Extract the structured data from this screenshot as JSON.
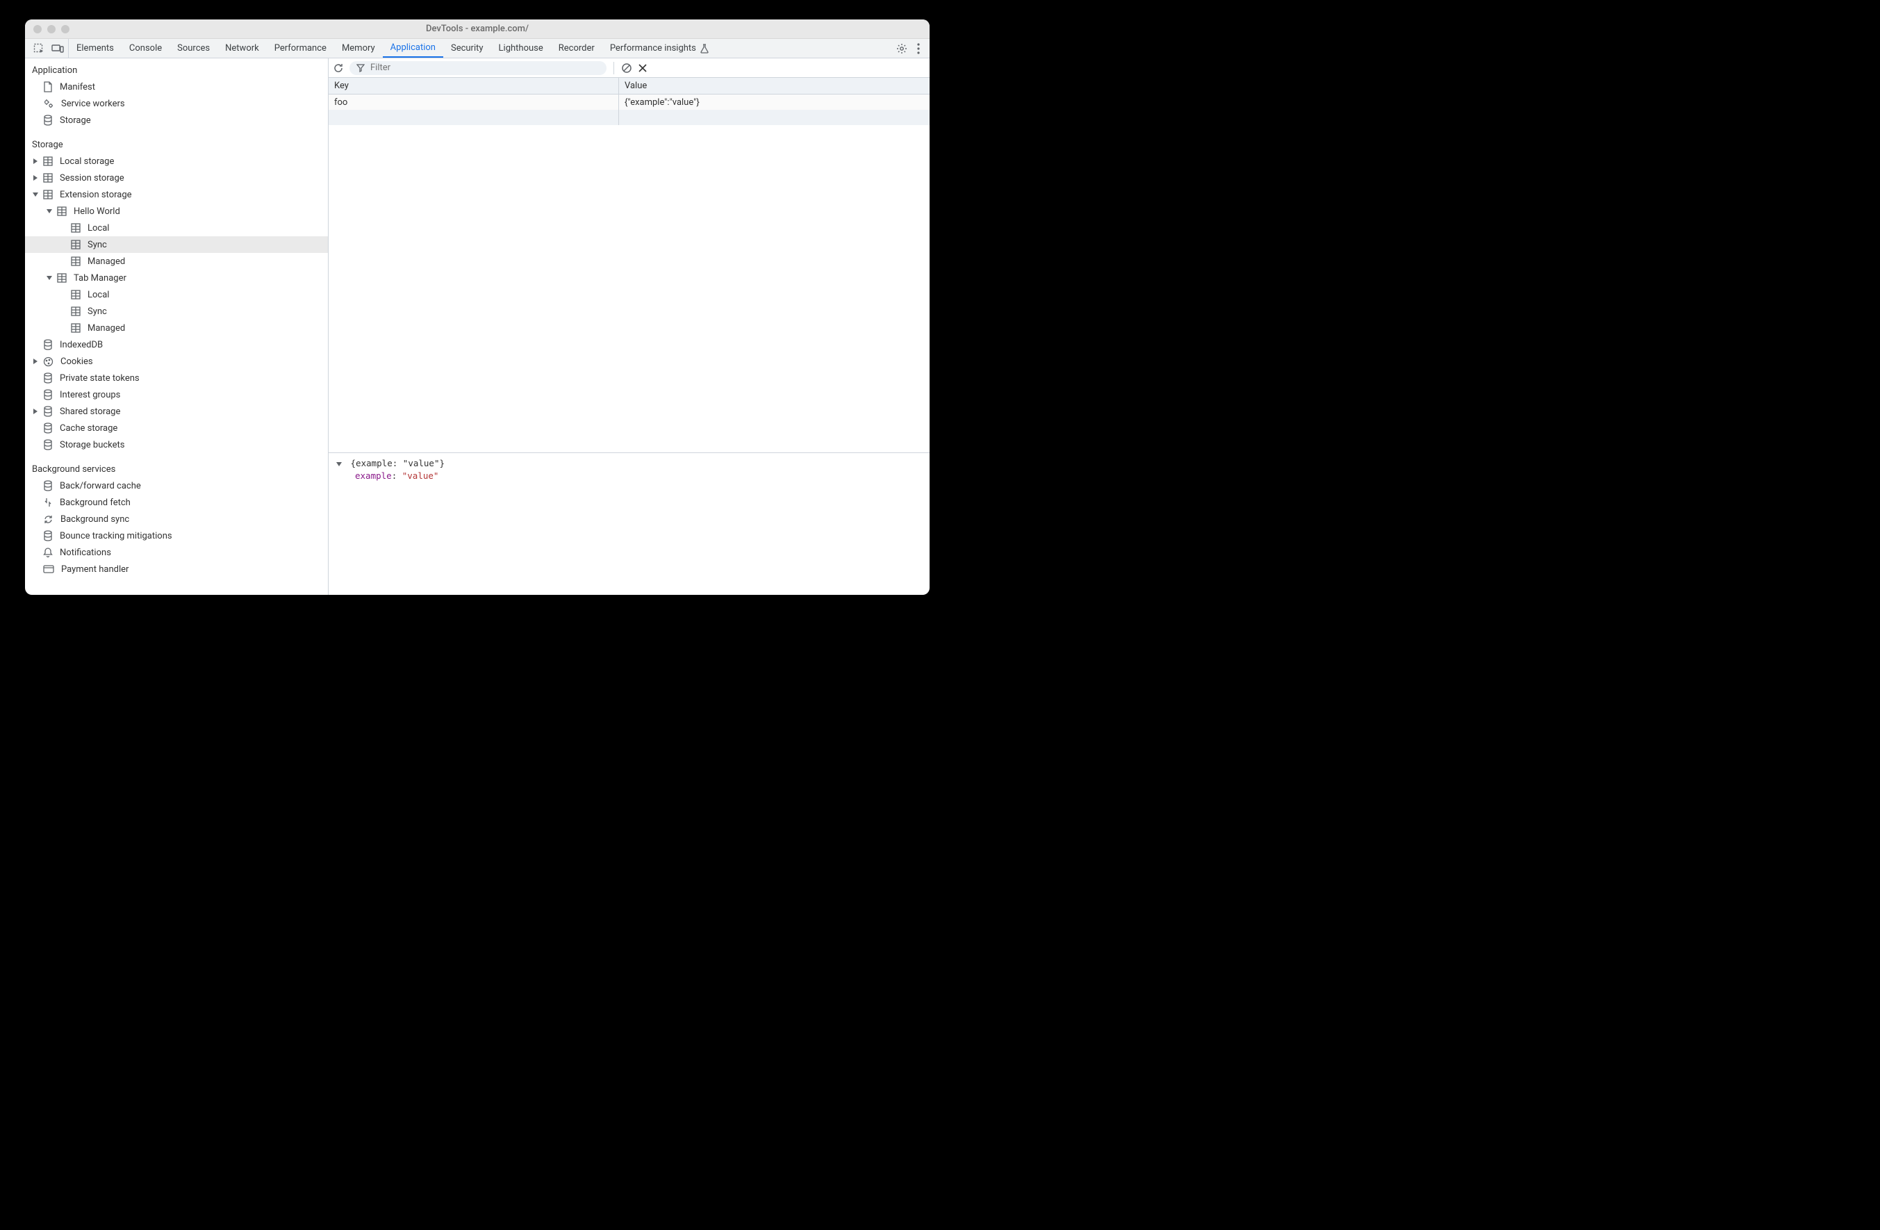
{
  "window": {
    "title": "DevTools - example.com/"
  },
  "tabs": [
    {
      "label": "Elements"
    },
    {
      "label": "Console"
    },
    {
      "label": "Sources"
    },
    {
      "label": "Network"
    },
    {
      "label": "Performance"
    },
    {
      "label": "Memory"
    },
    {
      "label": "Application",
      "active": true
    },
    {
      "label": "Security"
    },
    {
      "label": "Lighthouse"
    },
    {
      "label": "Recorder"
    },
    {
      "label": "Performance insights"
    }
  ],
  "sidebar": {
    "sections": [
      {
        "title": "Application",
        "items": [
          {
            "icon": "file",
            "label": "Manifest"
          },
          {
            "icon": "gears",
            "label": "Service workers"
          },
          {
            "icon": "db",
            "label": "Storage"
          }
        ]
      },
      {
        "title": "Storage",
        "items": [
          {
            "icon": "table",
            "label": "Local storage",
            "tw": "right"
          },
          {
            "icon": "table",
            "label": "Session storage",
            "tw": "right"
          },
          {
            "icon": "table",
            "label": "Extension storage",
            "tw": "down",
            "children": [
              {
                "icon": "table",
                "label": "Hello World",
                "tw": "down",
                "children": [
                  {
                    "icon": "table",
                    "label": "Local"
                  },
                  {
                    "icon": "table",
                    "label": "Sync",
                    "selected": true
                  },
                  {
                    "icon": "table",
                    "label": "Managed"
                  }
                ]
              },
              {
                "icon": "table",
                "label": "Tab Manager",
                "tw": "down",
                "children": [
                  {
                    "icon": "table",
                    "label": "Local"
                  },
                  {
                    "icon": "table",
                    "label": "Sync"
                  },
                  {
                    "icon": "table",
                    "label": "Managed"
                  }
                ]
              }
            ]
          },
          {
            "icon": "db",
            "label": "IndexedDB"
          },
          {
            "icon": "cookie",
            "label": "Cookies",
            "tw": "right"
          },
          {
            "icon": "db",
            "label": "Private state tokens"
          },
          {
            "icon": "db",
            "label": "Interest groups"
          },
          {
            "icon": "db",
            "label": "Shared storage",
            "tw": "right"
          },
          {
            "icon": "db",
            "label": "Cache storage"
          },
          {
            "icon": "db",
            "label": "Storage buckets"
          }
        ]
      },
      {
        "title": "Background services",
        "items": [
          {
            "icon": "db",
            "label": "Back/forward cache"
          },
          {
            "icon": "fetch",
            "label": "Background fetch"
          },
          {
            "icon": "sync",
            "label": "Background sync"
          },
          {
            "icon": "db",
            "label": "Bounce tracking mitigations"
          },
          {
            "icon": "bell",
            "label": "Notifications"
          },
          {
            "icon": "card",
            "label": "Payment handler"
          }
        ]
      }
    ]
  },
  "filter": {
    "placeholder": "Filter"
  },
  "table": {
    "headers": {
      "key": "Key",
      "value": "Value"
    },
    "rows": [
      {
        "key": "foo",
        "value": "{\"example\":\"value\"}"
      }
    ]
  },
  "preview": {
    "line1": "{example: \"value\"}",
    "key": "example",
    "sep": ": ",
    "val": "\"value\""
  }
}
